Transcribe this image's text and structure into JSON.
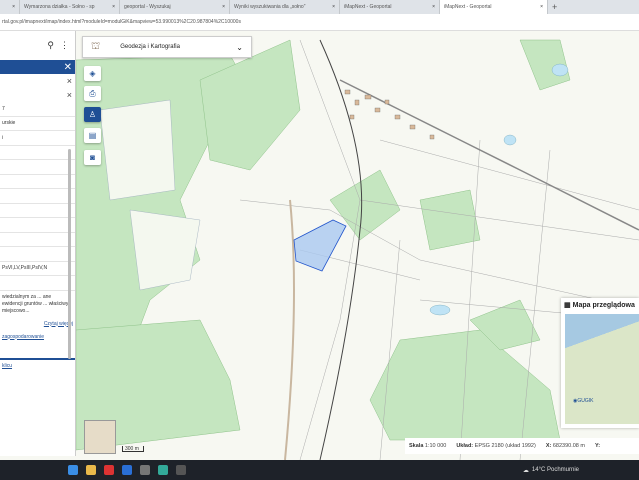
{
  "browser": {
    "tabs": [
      {
        "label": "Wymarzona działka - Sołno - sp",
        "active": false
      },
      {
        "label": "geoportal - Wyszukaj",
        "active": false
      },
      {
        "label": "Wyniki wyszukiwania dla „sołno”",
        "active": false
      },
      {
        "label": "iMapNext - Geoportal",
        "active": false
      },
      {
        "label": "iMapNext - Geoportal",
        "active": true
      }
    ],
    "new_tab": "+",
    "url": "rtal.gov.pl/imapnext/imap/index.html?moduleId=modulGiK&mapview=53.990013%2C20.987804%2C10000s"
  },
  "panel": {
    "rows": [
      "7",
      "urskie",
      "i",
      "",
      "",
      "",
      "",
      "",
      "",
      "",
      "",
      "PsVI,LV,PsIII,PsIV,N",
      ""
    ],
    "note": "wiedzialnym za ... ane ewidencji gruntów ... właściwy miejscowo...",
    "read_more": "Czytaj więcej",
    "link": "zagospodarowanie",
    "bottom_link": "klicu"
  },
  "theme_selector": {
    "label": "Geodezja i Kartografia"
  },
  "tools": [
    "layers-icon",
    "print-icon",
    "person-icon",
    "document-icon",
    "camera-icon"
  ],
  "status": {
    "scale_label": "Skala",
    "scale": "1:10 000",
    "crs_label": "Układ:",
    "crs": "EPSG 2180 (układ 1992)",
    "x_label": "X:",
    "x": "682390.08 m",
    "y_label": "Y:"
  },
  "overview": {
    "title": "Mapa przeglądowa",
    "logo": "GUGIK"
  },
  "scalebar": "300 m",
  "taskbar": {
    "weather": "14°C Pochmurnie"
  },
  "colors": {
    "accent": "#1f4f95",
    "forest": "#c5e6c0",
    "parcel": "#a9c8f0"
  }
}
